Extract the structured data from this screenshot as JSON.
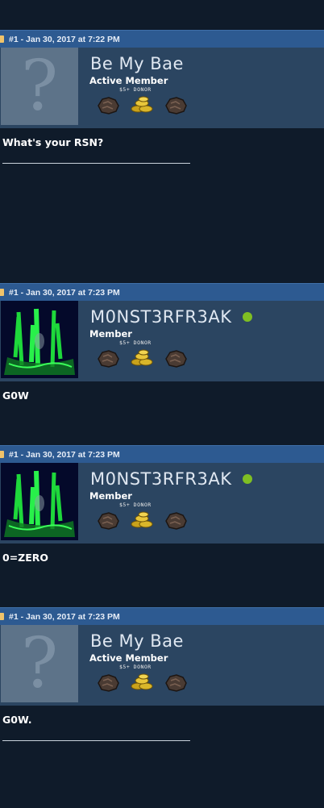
{
  "posts": [
    {
      "header": "#1 - Jan 30, 2017 at 7:22 PM",
      "username": "Be My Bae",
      "rank": "Active Member",
      "donor": "$5+ DONOR",
      "avatar": "default-question-avatar",
      "online": false,
      "body": "What's your RSN?",
      "signature_line": true
    },
    {
      "header": "#1 - Jan 30, 2017 at 7:23 PM",
      "username": "M0NST3RFR3AK",
      "rank": "Member",
      "donor": "$5+ DONOR",
      "avatar": "monster-energy-avatar",
      "online": true,
      "body": "G0W",
      "signature_line": false
    },
    {
      "header": "#1 - Jan 30, 2017 at 7:23 PM",
      "username": "M0NST3RFR3AK",
      "rank": "Member",
      "donor": "$5+ DONOR",
      "avatar": "monster-energy-avatar",
      "online": true,
      "body": "0=ZERO",
      "signature_line": false
    },
    {
      "header": "#1 - Jan 30, 2017 at 7:23 PM",
      "username": "Be My Bae",
      "rank": "Active Member",
      "donor": "$5+ DONOR",
      "avatar": "default-question-avatar",
      "online": false,
      "body": "G0W.",
      "signature_line": true
    }
  ],
  "colors": {
    "page_background": "#0f1b2a",
    "header_bar": "#2d5a91",
    "user_panel": "#2b4561",
    "online_indicator": "#7fbf23"
  },
  "icons": [
    "post-marker-icon",
    "dark-rock-badge-icon",
    "gold-coins-badge-icon",
    "online-status-icon"
  ]
}
